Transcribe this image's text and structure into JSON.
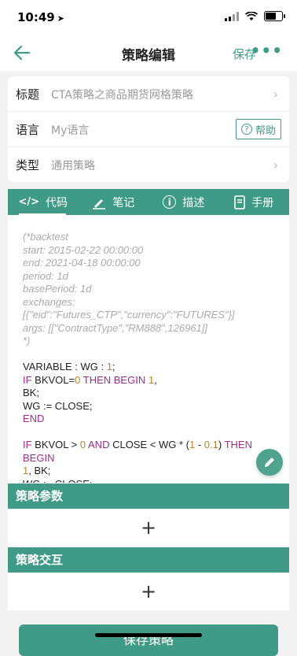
{
  "status": {
    "time": "10:49"
  },
  "nav": {
    "title": "策略编辑",
    "save": "保存"
  },
  "form": {
    "title_label": "标题",
    "title_value": "CTA策略之商品期货网格策略",
    "lang_label": "语言",
    "lang_value": "My语言",
    "help": "帮助",
    "type_label": "类型",
    "type_value": "通用策略"
  },
  "tabs": [
    "代码",
    "笔记",
    "描述",
    "手册"
  ],
  "code": {
    "c1": "(*backtest",
    "c2": "start: 2015-02-22 00:00:00",
    "c3": "end: 2021-04-18 00:00:00",
    "c4": "period: 1d",
    "c5": "basePeriod: 1d",
    "c6": "exchanges:",
    "c7": "[{\"eid\":\"Futures_CTP\",\"currency\":\"FUTURES\"}]",
    "c8": "args: [[\"ContractType\",\"RM888\",126961]]",
    "c9": "*)"
  },
  "sections": {
    "params": "策略参数",
    "interact": "策略交互",
    "add": "+"
  },
  "bottom": {
    "save_strategy": "保存策略"
  },
  "colors": {
    "accent": "#3f9b87"
  }
}
